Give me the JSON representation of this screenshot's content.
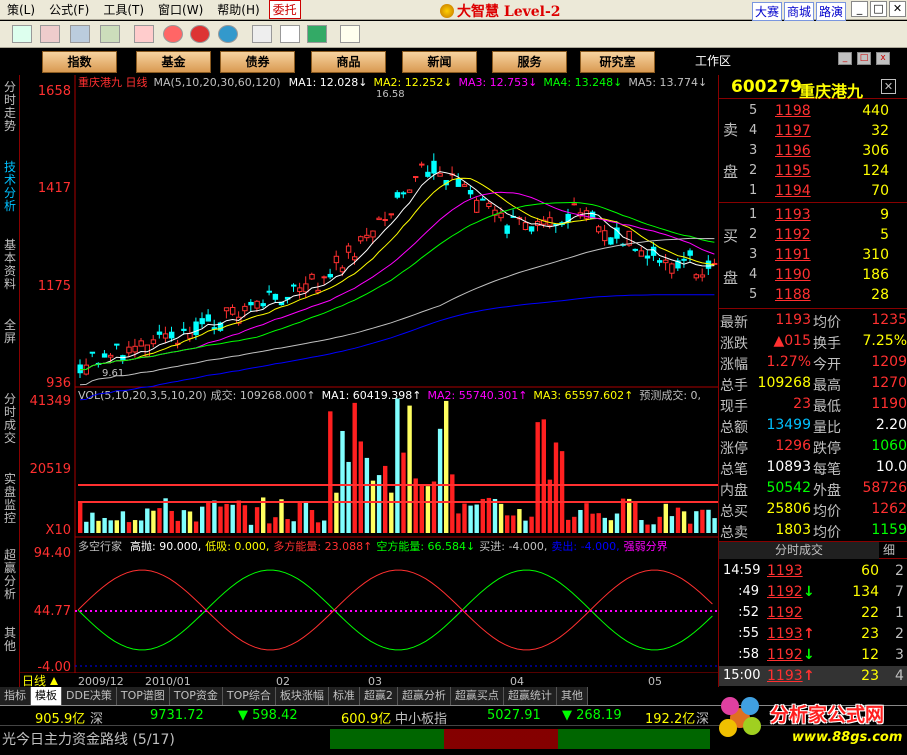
{
  "menu": {
    "items": [
      "策(L)",
      "公式(F)",
      "工具(T)",
      "窗口(W)",
      "帮助(H)"
    ],
    "entrust": "委托"
  },
  "app": {
    "title": "大智慧 Level-2",
    "links": [
      "大赛",
      "商城",
      "路演"
    ]
  },
  "nav": {
    "buttons": [
      "指数",
      "基金",
      "债券",
      "商品",
      "新闻",
      "服务",
      "研究室"
    ],
    "workspace": "工作区"
  },
  "side_tabs": [
    "分时走势",
    "技术分析",
    "基本资料",
    "全屏",
    "分时成交",
    "实盘监控",
    "超赢分析",
    "其他"
  ],
  "chart": {
    "header": "重庆港九 日线",
    "ma_params": "MA(5,10,20,30,60,120)",
    "ma_values": [
      {
        "label": "MA1: 12.028↓",
        "color": "#ffffff"
      },
      {
        "label": "MA2: 12.252↓",
        "color": "#ffff00"
      },
      {
        "label": "MA3: 12.753↓",
        "color": "#ff00ff"
      },
      {
        "label": "MA4: 13.248↓",
        "color": "#00ff00"
      },
      {
        "label": "MA5: 13.774↓",
        "color": "#c0c0c0"
      }
    ],
    "price_axis": [
      "1658",
      "1417",
      "1175",
      "936"
    ],
    "high_label": "16.58",
    "low_label": "9.61",
    "vol_header": "VOL(5,10,20,3,5,10,20)",
    "vol_values": [
      {
        "label": "成交: 109268.000↑",
        "color": "#c0c0c0"
      },
      {
        "label": "MA1: 60419.398↑",
        "color": "#ffffff"
      },
      {
        "label": "MA2: 55740.301↑",
        "color": "#ff00ff"
      },
      {
        "label": "MA3: 65597.602↑",
        "color": "#ffff00"
      },
      {
        "label": "预测成交: 0,",
        "color": "#c0c0c0"
      }
    ],
    "vol_axis": [
      "41349",
      "20519",
      "X10"
    ],
    "ind_header": "多空行家",
    "ind_values": [
      {
        "label": "高抛: 90.000,",
        "color": "#ffffff"
      },
      {
        "label": "低吸: 0.000,",
        "color": "#ffff00"
      },
      {
        "label": "多方能量: 23.088↑",
        "color": "#ff3030"
      },
      {
        "label": "空方能量: 66.584↓",
        "color": "#00ff00"
      },
      {
        "label": "买进: -4.000,",
        "color": "#c0c0c0"
      },
      {
        "label": "卖出: -4.000,",
        "color": "#0000ff"
      },
      {
        "label": "强弱分界",
        "color": "#ff00ff"
      }
    ],
    "ind_axis": [
      "94.40",
      "44.77",
      "-4.00"
    ],
    "date_labels": [
      "2009/12",
      "2010/01",
      "02",
      "03",
      "04",
      "05"
    ],
    "period_label": "日线"
  },
  "quote": {
    "code": "600279",
    "name": "重庆港九",
    "sells": [
      {
        "level": "5",
        "price": "1198",
        "vol": "440"
      },
      {
        "level": "4",
        "price": "1197",
        "vol": "32"
      },
      {
        "level": "3",
        "price": "1196",
        "vol": "306"
      },
      {
        "level": "2",
        "price": "1195",
        "vol": "124"
      },
      {
        "level": "1",
        "price": "1194",
        "vol": "70"
      }
    ],
    "buys": [
      {
        "level": "1",
        "price": "1193",
        "vol": "9"
      },
      {
        "level": "2",
        "price": "1192",
        "vol": "5"
      },
      {
        "level": "3",
        "price": "1191",
        "vol": "310"
      },
      {
        "level": "4",
        "price": "1190",
        "vol": "186"
      },
      {
        "level": "5",
        "price": "1188",
        "vol": "28"
      }
    ],
    "sell_label": [
      "卖",
      "盘"
    ],
    "buy_label": [
      "买",
      "盘"
    ],
    "stats": [
      {
        "l1": "最新",
        "v1": "1193",
        "c1": "#ff3030",
        "l2": "均价",
        "v2": "1235",
        "c2": "#ff3030"
      },
      {
        "l1": "涨跌",
        "v1": "▲015",
        "c1": "#ff3030",
        "l2": "换手",
        "v2": "7.25%",
        "c2": "#ffff00"
      },
      {
        "l1": "涨幅",
        "v1": "1.27%",
        "c1": "#ff3030",
        "l2": "今开",
        "v2": "1209",
        "c2": "#ff3030"
      },
      {
        "l1": "总手",
        "v1": "109268",
        "c1": "#ffff00",
        "l2": "最高",
        "v2": "1270",
        "c2": "#ff3030"
      },
      {
        "l1": "现手",
        "v1": "23",
        "c1": "#ff3030",
        "l2": "最低",
        "v2": "1190",
        "c2": "#ff3030"
      },
      {
        "l1": "总额",
        "v1": "13499",
        "c1": "#00c0ff",
        "l2": "量比",
        "v2": "2.20",
        "c2": "#ffffff"
      },
      {
        "l1": "涨停",
        "v1": "1296",
        "c1": "#ff3030",
        "l2": "跌停",
        "v2": "1060",
        "c2": "#00ff00"
      },
      {
        "l1": "总笔",
        "v1": "10893",
        "c1": "#ffffff",
        "l2": "每笔",
        "v2": "10.0",
        "c2": "#ffffff"
      },
      {
        "l1": "内盘",
        "v1": "50542",
        "c1": "#00ff00",
        "l2": "外盘",
        "v2": "58726",
        "c2": "#ff3030"
      },
      {
        "l1": "总买",
        "v1": "25806",
        "c1": "#ffff00",
        "l2": "均价",
        "v2": "1262",
        "c2": "#ff3030"
      },
      {
        "l1": "总卖",
        "v1": "1803",
        "c1": "#ffff00",
        "l2": "均价",
        "v2": "1159",
        "c2": "#00ff00"
      }
    ],
    "trades_tab": "分时成交",
    "trades_tab_alt": "细",
    "trades": [
      {
        "time": "14:59",
        "price": "1193",
        "arrow": "",
        "vol": "60",
        "n": "2",
        "pc": "#ff3030",
        "ac": "#ff3030"
      },
      {
        "time": ":49",
        "price": "1192",
        "arrow": "↓",
        "vol": "134",
        "n": "7",
        "pc": "#ff3030",
        "ac": "#00ff00"
      },
      {
        "time": ":52",
        "price": "1192",
        "arrow": "",
        "vol": "22",
        "n": "1",
        "pc": "#ff3030",
        "ac": "#ff3030"
      },
      {
        "time": ":55",
        "price": "1193",
        "arrow": "↑",
        "vol": "23",
        "n": "2",
        "pc": "#ff3030",
        "ac": "#ff3030"
      },
      {
        "time": ":58",
        "price": "1192",
        "arrow": "↓",
        "vol": "12",
        "n": "3",
        "pc": "#ff3030",
        "ac": "#00ff00"
      },
      {
        "time": "15:00",
        "price": "1193",
        "arrow": "↑",
        "vol": "23",
        "n": "4",
        "pc": "#ff3030",
        "ac": "#ff3030"
      }
    ]
  },
  "bottom_tabs": [
    "指标",
    "模板",
    "DDE决策",
    "TOP谱图",
    "TOP资金",
    "TOP综合",
    "板块涨幅",
    "标准",
    "超赢2",
    "超赢分析",
    "超赢买点",
    "超赢统计",
    "其他"
  ],
  "status": {
    "a": "905.9亿",
    "b": "深",
    "c": "9731.72",
    "d": "▼ 598.42",
    "e": "600.9亿",
    "f": "中小板指",
    "g": "5027.91",
    "h": "▼ 268.19",
    "i": "192.2亿",
    "j": "深"
  },
  "ticker": "光今日主力资金路线 (5/17)",
  "watermark": {
    "title": "分析家公式网",
    "url": "www.88gs.com"
  }
}
